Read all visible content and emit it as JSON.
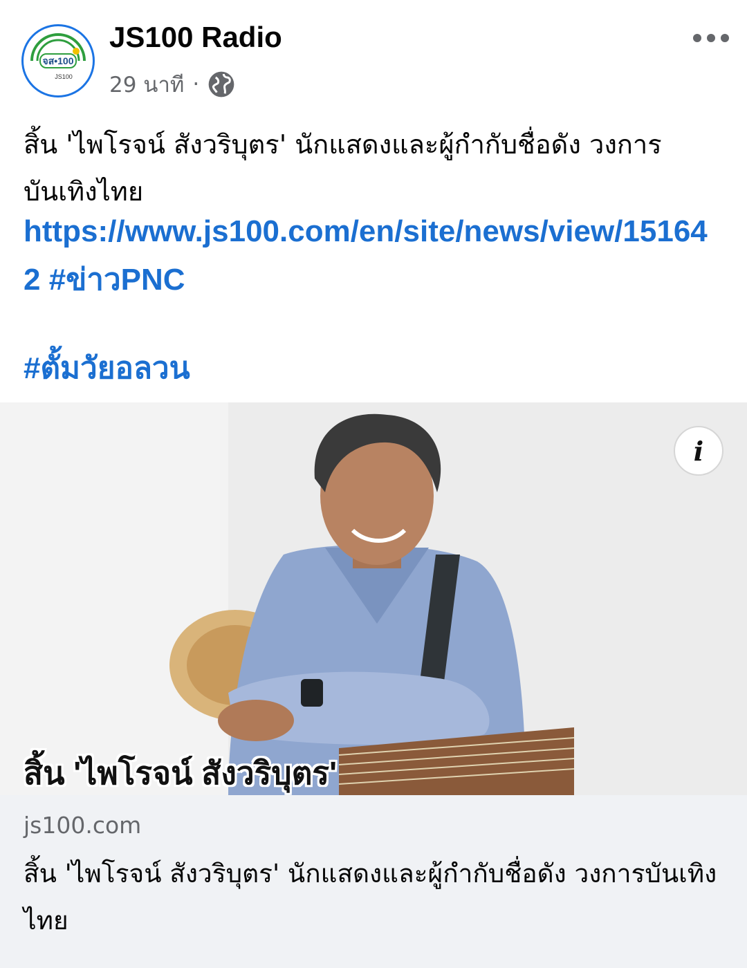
{
  "header": {
    "page_name": "JS100 Radio",
    "time": "29 นาที",
    "separator": "·",
    "privacy_icon": "globe-icon",
    "more_icon": "more-horizontal-icon",
    "avatar_text": "จส•100",
    "avatar_subtext": "JS100"
  },
  "post": {
    "text": "สิ้น 'ไพโรจน์ สังวริบุตร' นักแสดงและผู้กำกับชื่อดัง วงการบันเทิงไทย",
    "link": "https://www.js100.com/en/site/news/view/151642",
    "hashtag1": "#ข่าวPNC",
    "hashtag2": "#ตั้มวัยอลวน"
  },
  "photo": {
    "overlay_text": "สิ้น 'ไพโรจน์ สังวริบุตร'",
    "info_label": "i"
  },
  "link_card": {
    "domain": "js100.com",
    "title": "สิ้น 'ไพโรจน์ สังวริบุตร' นักแสดงและผู้กำกับชื่อดัง วงการบันเทิงไทย"
  },
  "colors": {
    "link": "#1b6fd1",
    "secondary_text": "#65676b",
    "card_bg": "#f0f2f5",
    "avatar_ring": "#1b74e4",
    "logo_green": "#2e9e3e"
  }
}
